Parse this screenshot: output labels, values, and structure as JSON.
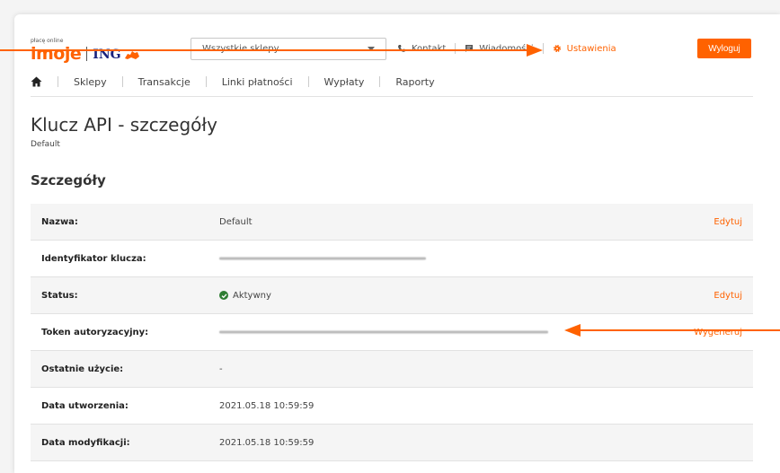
{
  "header": {
    "logo_small": "płacę online",
    "logo_imoje": "imoje",
    "logo_ing": "ING",
    "store_select": {
      "value": "Wszystkie sklepy"
    },
    "links": [
      {
        "label": "Kontakt",
        "icon": "phone-icon"
      },
      {
        "label": "Wiadomości",
        "icon": "message-icon"
      },
      {
        "label": "Ustawienia",
        "icon": "gear-icon",
        "active": true
      }
    ],
    "logout_label": "Wyloguj"
  },
  "nav": {
    "home_icon": "home-icon",
    "items": [
      "Sklepy",
      "Transakcje",
      "Linki płatności",
      "Wypłaty",
      "Raporty"
    ]
  },
  "page": {
    "title": "Klucz API - szczegóły",
    "subtitle": "Default",
    "section_title": "Szczegóły"
  },
  "details": [
    {
      "label": "Nazwa:",
      "value": "Default",
      "action": "Edytuj"
    },
    {
      "label": "Identyfikator klucza:",
      "value": "",
      "masked": true
    },
    {
      "label": "Status:",
      "value": "Aktywny",
      "status_icon": "check-circle-icon",
      "action": "Edytuj"
    },
    {
      "label": "Token autoryzacyjny:",
      "value": "",
      "masked": true,
      "action": "Wygeneruj"
    },
    {
      "label": "Ostatnie użycie:",
      "value": "-"
    },
    {
      "label": "Data utworzenia:",
      "value": "2021.05.18 10:59:59"
    },
    {
      "label": "Data modyfikacji:",
      "value": "2021.05.18 10:59:59"
    }
  ],
  "colors": {
    "accent": "#ff6200",
    "brand_ing": "#1a237e",
    "status_active": "#2e7d32",
    "annotation_arrow": "#ff6200"
  }
}
